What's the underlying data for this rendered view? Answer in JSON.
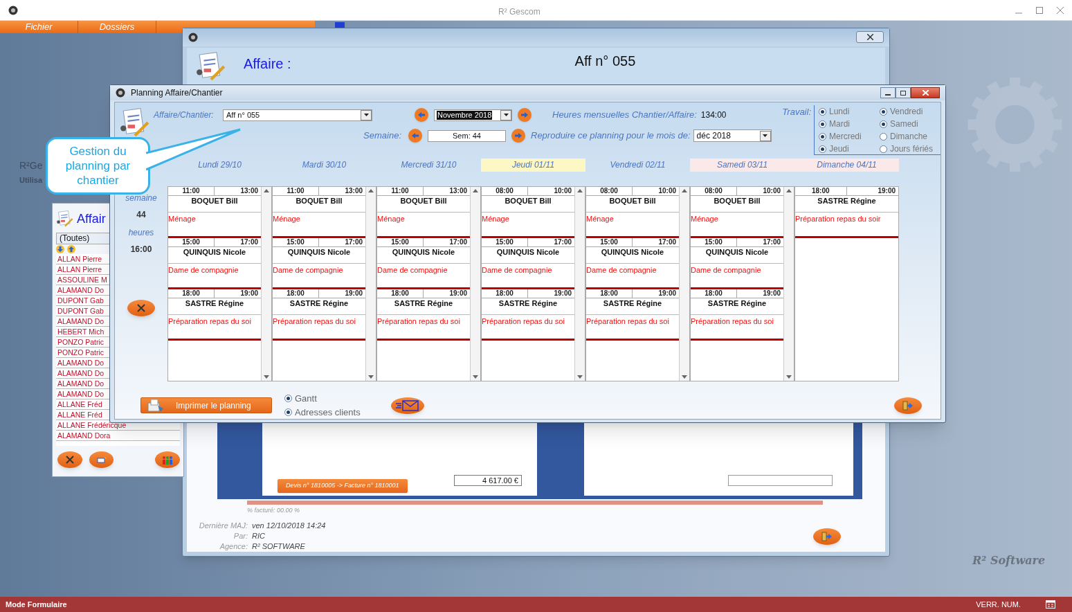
{
  "window": {
    "title": "R² Gescom"
  },
  "menu": [
    {
      "label": "Fichier"
    },
    {
      "label": "Dossiers"
    }
  ],
  "background_text": [
    "R²Ge",
    "Utilisa"
  ],
  "logo": "R² Software",
  "affaire_window": {
    "heading": "Affaire :",
    "number": "Aff n° 055",
    "link_button": "Devis n° 1810005 -> Facture n° 1810001",
    "amount": "4 617.00 €",
    "invoiced": "% facturé: 00.00 %",
    "meta": [
      {
        "label": "Dernière MAJ:",
        "value": "ven 12/10/2018 14:24"
      },
      {
        "label": "Par:",
        "value": "RIC"
      },
      {
        "label": "Agence:",
        "value": "R² SOFTWARE"
      }
    ]
  },
  "list_window": {
    "title": "Affair",
    "filter": "(Toutes)",
    "rows": [
      "ALLAN Pierre",
      "ALLAN Pierre",
      "ASSOULINE M",
      "ALAMAND Do",
      "DUPONT Gab",
      "DUPONT Gab",
      "ALAMAND Do",
      "HEBERT Mich",
      "PONZO Patric",
      "PONZO Patric",
      "ALAMAND Do",
      "ALAMAND Do",
      "ALAMAND Do",
      "ALAMAND Do",
      "ALLANE Fréd",
      "ALLANE Fréd",
      "ALLANE Frédéricque",
      "ALAMAND Dora"
    ]
  },
  "planning": {
    "title": "Planning Affaire/Chantier",
    "affaire_label": "Affaire/Chantier:",
    "affaire_value": "Aff n° 055",
    "month": "Novembre 2018",
    "week_label": "Semaine:",
    "week": "Sem: 44",
    "hours_label": "Heures mensuelles Chantier/Affaire:",
    "hours": "134:00",
    "copy_label": "Reproduire ce planning pour le mois de:",
    "copy_month": "déc 2018",
    "work_label": "Travail:",
    "work_days": [
      {
        "label": "Lundi",
        "checked": true
      },
      {
        "label": "Vendredi",
        "checked": true
      },
      {
        "label": "Mardi",
        "checked": true
      },
      {
        "label": "Samedi",
        "checked": true
      },
      {
        "label": "Mercredi",
        "checked": true
      },
      {
        "label": "Dimanche",
        "checked": false
      },
      {
        "label": "Jeudi",
        "checked": true
      },
      {
        "label": "Jours fériés",
        "checked": false
      }
    ],
    "summary": [
      {
        "label": "semaine",
        "value": "44"
      },
      {
        "label": "heures",
        "value": "16:00"
      }
    ],
    "days": [
      {
        "label": "Lundi 29/10",
        "kind": "normal",
        "scrollbar": true,
        "entries": [
          {
            "start": "11:00",
            "end": "13:00",
            "name": "BOQUET Bill",
            "task": "Ménage"
          },
          {
            "start": "15:00",
            "end": "17:00",
            "name": "QUINQUIS Nicole",
            "task": "Dame de compagnie"
          },
          {
            "start": "18:00",
            "end": "19:00",
            "name": "SASTRE Régine",
            "task": "Préparation repas du soi"
          }
        ]
      },
      {
        "label": "Mardi 30/10",
        "kind": "normal",
        "scrollbar": true,
        "entries": [
          {
            "start": "11:00",
            "end": "13:00",
            "name": "BOQUET Bill",
            "task": "Ménage"
          },
          {
            "start": "15:00",
            "end": "17:00",
            "name": "QUINQUIS Nicole",
            "task": "Dame de compagnie"
          },
          {
            "start": "18:00",
            "end": "19:00",
            "name": "SASTRE Régine",
            "task": "Préparation repas du soi"
          }
        ]
      },
      {
        "label": "Mercredi 31/10",
        "kind": "normal",
        "scrollbar": true,
        "entries": [
          {
            "start": "11:00",
            "end": "13:00",
            "name": "BOQUET Bill",
            "task": "Ménage"
          },
          {
            "start": "15:00",
            "end": "17:00",
            "name": "QUINQUIS Nicole",
            "task": "Dame de compagnie"
          },
          {
            "start": "18:00",
            "end": "19:00",
            "name": "SASTRE Régine",
            "task": "Préparation repas du soi"
          }
        ]
      },
      {
        "label": "Jeudi 01/11",
        "kind": "today",
        "scrollbar": true,
        "entries": [
          {
            "start": "08:00",
            "end": "10:00",
            "name": "BOQUET Bill",
            "task": "Ménage"
          },
          {
            "start": "15:00",
            "end": "17:00",
            "name": "QUINQUIS Nicole",
            "task": "Dame de compagnie"
          },
          {
            "start": "18:00",
            "end": "19:00",
            "name": "SASTRE Régine",
            "task": "Préparation repas du soi"
          }
        ]
      },
      {
        "label": "Vendredi 02/11",
        "kind": "normal",
        "scrollbar": true,
        "entries": [
          {
            "start": "08:00",
            "end": "10:00",
            "name": "BOQUET Bill",
            "task": "Ménage"
          },
          {
            "start": "15:00",
            "end": "17:00",
            "name": "QUINQUIS Nicole",
            "task": "Dame de compagnie"
          },
          {
            "start": "18:00",
            "end": "19:00",
            "name": "SASTRE Régine",
            "task": "Préparation repas du soi"
          }
        ]
      },
      {
        "label": "Samedi 03/11",
        "kind": "weekend",
        "scrollbar": true,
        "entries": [
          {
            "start": "08:00",
            "end": "10:00",
            "name": "BOQUET Bill",
            "task": "Ménage"
          },
          {
            "start": "15:00",
            "end": "17:00",
            "name": "QUINQUIS Nicole",
            "task": "Dame de compagnie"
          },
          {
            "start": "18:00",
            "end": "19:00",
            "name": "SASTRE Régine",
            "task": "Préparation repas du soi"
          }
        ]
      },
      {
        "label": "Dimanche 04/11",
        "kind": "weekend",
        "scrollbar": false,
        "entries": [
          {
            "start": "18:00",
            "end": "19:00",
            "name": "SASTRE Régine",
            "task": "Préparation repas du soir"
          }
        ]
      }
    ],
    "print_button": "Imprimer le planning",
    "options": [
      {
        "label": "Gantt",
        "checked": true
      },
      {
        "label": "Adresses clients",
        "checked": true
      }
    ]
  },
  "callout": "Gestion du planning par chantier",
  "status_bar": {
    "mode": "Mode Formulaire",
    "indicator": "VERR. NUM."
  }
}
